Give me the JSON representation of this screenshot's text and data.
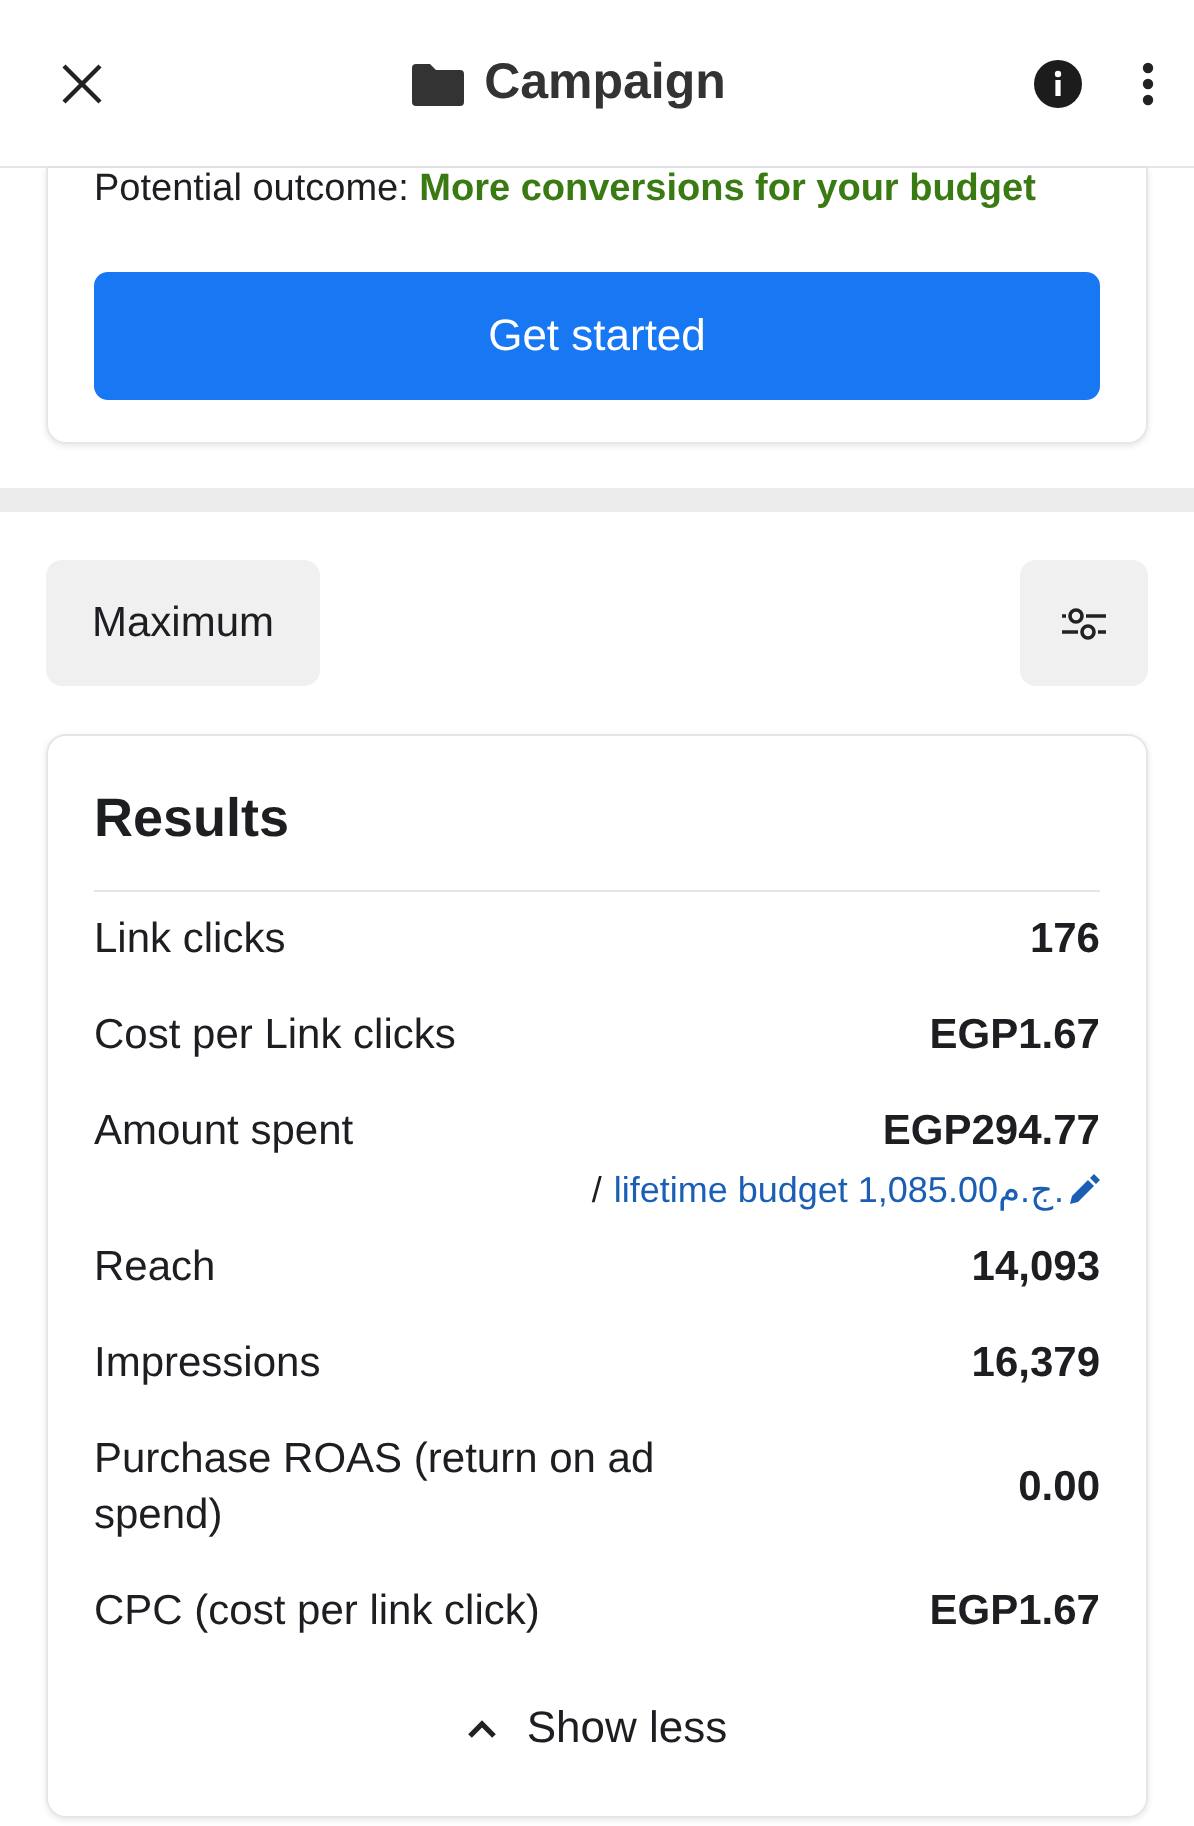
{
  "header": {
    "title": "Campaign"
  },
  "outcome": {
    "label": "Potential outcome:",
    "value": "More conversions for your budget"
  },
  "cta": {
    "label": "Get started"
  },
  "filter": {
    "label": "Maximum"
  },
  "results": {
    "title": "Results",
    "rows": [
      {
        "label": "Link clicks",
        "value": "176"
      },
      {
        "label": "Cost per Link clicks",
        "value": "EGP1.67"
      },
      {
        "label": "Amount spent",
        "value": "EGP294.77",
        "note": {
          "separator": "/",
          "text": "lifetime budget 1,085.00ج.م."
        }
      },
      {
        "label": "Reach",
        "value": "14,093"
      },
      {
        "label": "Impressions",
        "value": "16,379"
      },
      {
        "label": "Purchase ROAS (return on ad spend)",
        "value": "0.00"
      },
      {
        "label": "CPC (cost per link click)",
        "value": "EGP1.67"
      }
    ],
    "toggle": {
      "label": "Show less",
      "expanded": true
    }
  }
}
